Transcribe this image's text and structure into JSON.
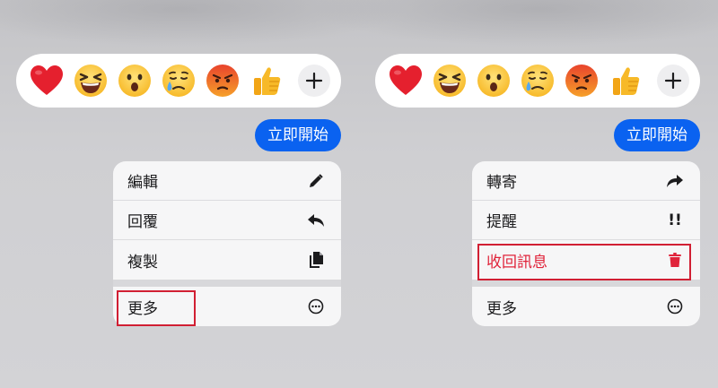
{
  "left_panel": {
    "bubble_text": "立即開始",
    "menu_items": [
      {
        "label": "編輯",
        "icon": "pencil-icon"
      },
      {
        "label": "回覆",
        "icon": "reply-icon"
      },
      {
        "label": "複製",
        "icon": "copy-icon"
      },
      {
        "label": "更多",
        "icon": "more-circle-icon"
      }
    ]
  },
  "right_panel": {
    "bubble_text": "立即開始",
    "menu_items": [
      {
        "label": "轉寄",
        "icon": "forward-icon"
      },
      {
        "label": "提醒",
        "icon": "remind-icon",
        "glyph": "!!"
      },
      {
        "label": "收回訊息",
        "icon": "trash-icon",
        "color": "#e0243b"
      },
      {
        "label": "更多",
        "icon": "more-circle-icon"
      }
    ]
  },
  "reactions": [
    "heart",
    "laughing",
    "surprised",
    "crying",
    "angry",
    "thumbs-up"
  ],
  "colors": {
    "bubble": "#0a62f0",
    "danger": "#e0243b",
    "highlight_border": "#d11f33"
  }
}
